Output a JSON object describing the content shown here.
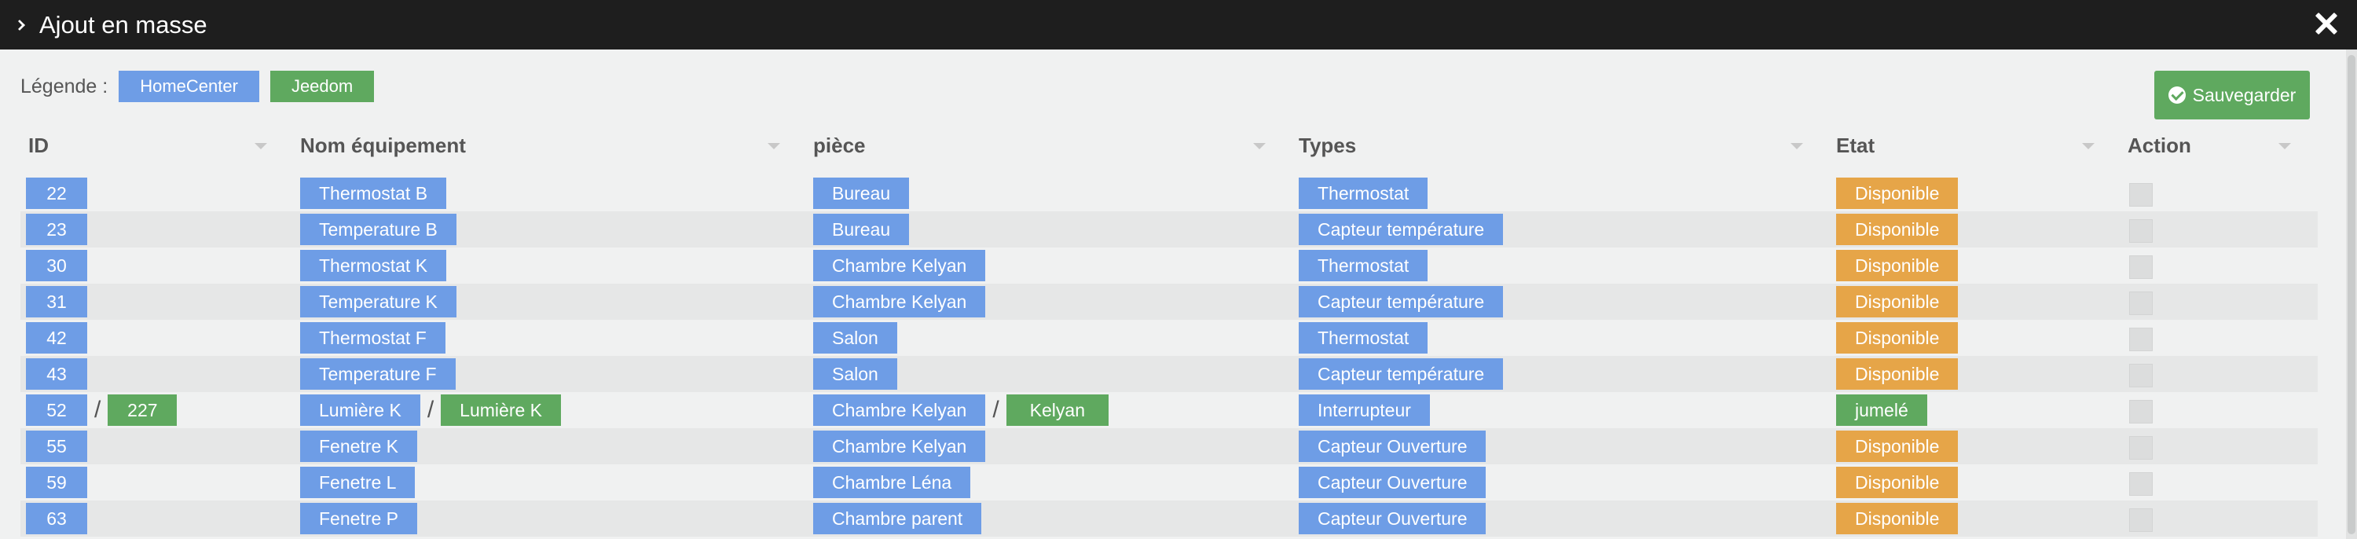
{
  "window": {
    "title": "Ajout en masse"
  },
  "legend": {
    "label": "Légende :",
    "home_center": "HomeCenter",
    "jeedom": "Jeedom"
  },
  "toolbar": {
    "save_label": "Sauvegarder"
  },
  "colors": {
    "blue": "#6e9de6",
    "green": "#5fa95f",
    "orange": "#e6a548",
    "titlebar": "#1e1e1e"
  },
  "columns": {
    "id": "ID",
    "name": "Nom équipement",
    "room": "pièce",
    "types": "Types",
    "state": "Etat",
    "action": "Action"
  },
  "rows": [
    {
      "id": "22",
      "name": "Thermostat B",
      "room": "Bureau",
      "type": "Thermostat",
      "state": "Disponible"
    },
    {
      "id": "23",
      "name": "Temperature B",
      "room": "Bureau",
      "type": "Capteur température",
      "state": "Disponible"
    },
    {
      "id": "30",
      "name": "Thermostat K",
      "room": "Chambre Kelyan",
      "type": "Thermostat",
      "state": "Disponible"
    },
    {
      "id": "31",
      "name": "Temperature K",
      "room": "Chambre Kelyan",
      "type": "Capteur température",
      "state": "Disponible"
    },
    {
      "id": "42",
      "name": "Thermostat F",
      "room": "Salon",
      "type": "Thermostat",
      "state": "Disponible"
    },
    {
      "id": "43",
      "name": "Temperature F",
      "room": "Salon",
      "type": "Capteur température",
      "state": "Disponible"
    },
    {
      "id": "52",
      "id_jeedom": "227",
      "name": "Lumière K",
      "name_jeedom": "Lumière K",
      "room": "Chambre Kelyan",
      "room_jeedom": "Kelyan",
      "type": "Interrupteur",
      "state": "jumelé",
      "separator": "/"
    },
    {
      "id": "55",
      "name": "Fenetre K",
      "room": "Chambre Kelyan",
      "type": "Capteur Ouverture",
      "state": "Disponible"
    },
    {
      "id": "59",
      "name": "Fenetre L",
      "room": "Chambre Léna",
      "type": "Capteur Ouverture",
      "state": "Disponible"
    },
    {
      "id": "63",
      "name": "Fenetre P",
      "room": "Chambre parent",
      "type": "Capteur Ouverture",
      "state": "Disponible"
    }
  ]
}
